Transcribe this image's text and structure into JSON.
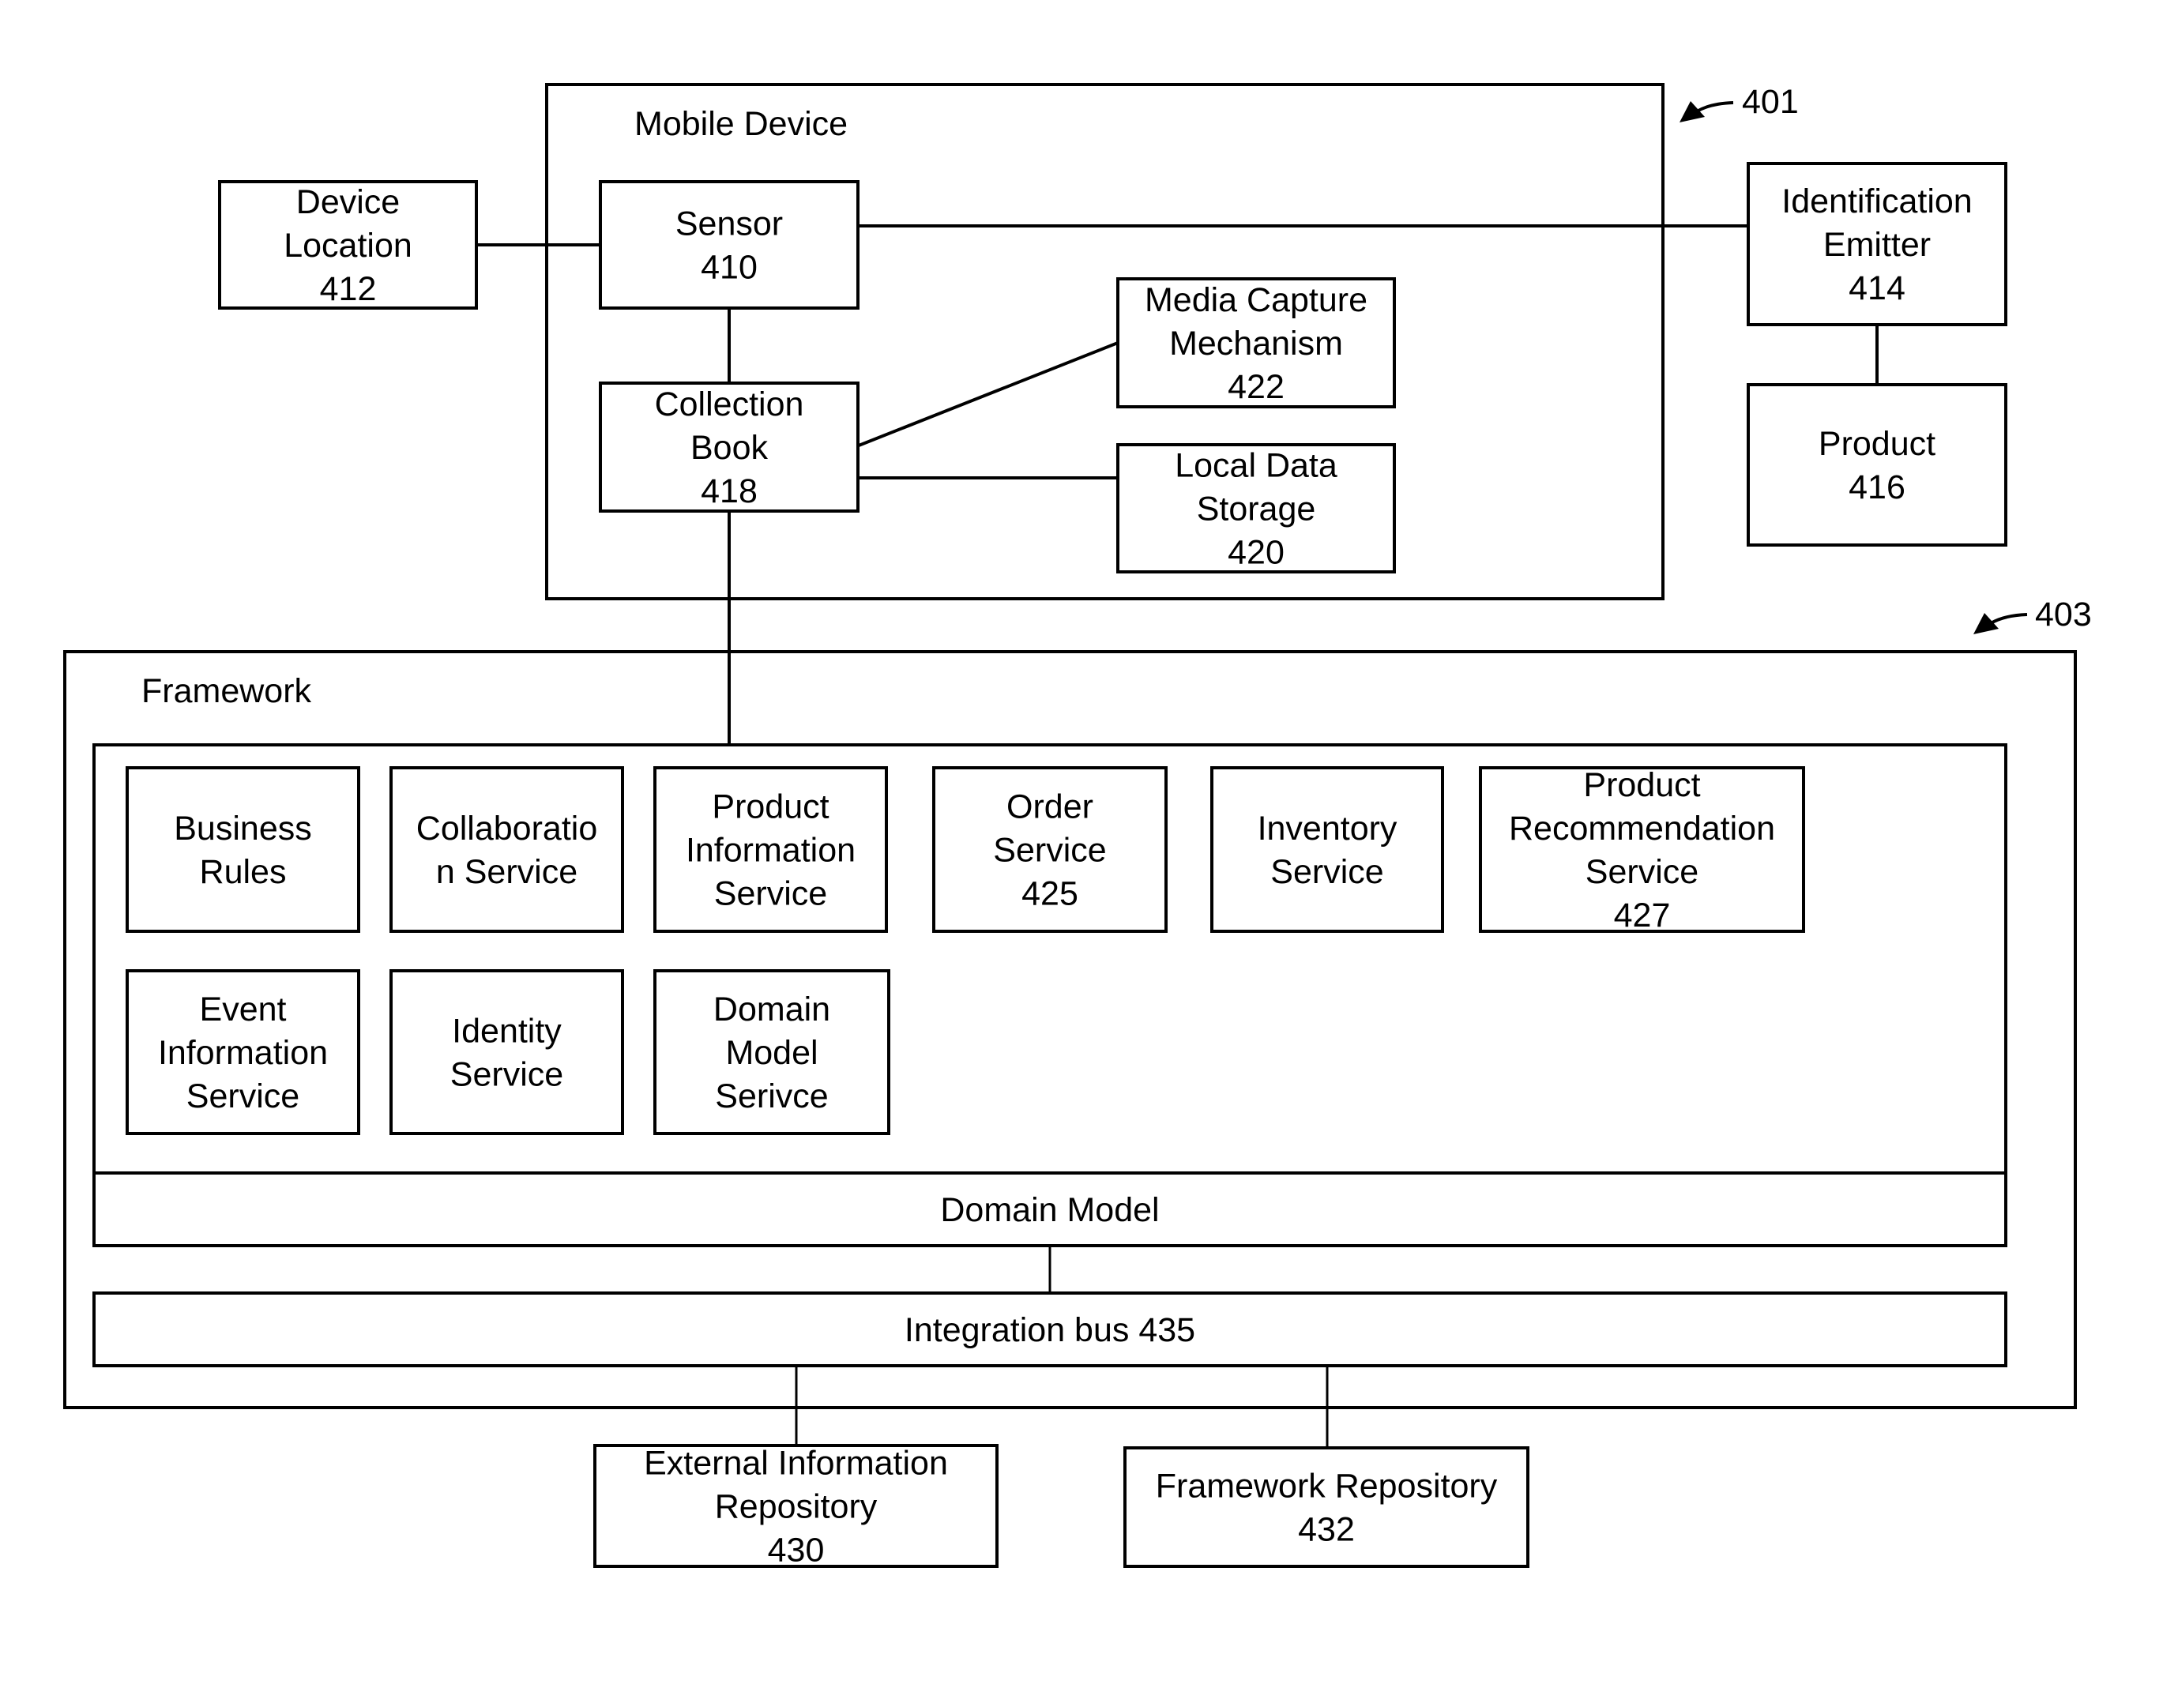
{
  "diagram": {
    "callouts": [
      {
        "id": "mobile-device-ref",
        "label": "401"
      },
      {
        "id": "framework-ref",
        "label": "403"
      }
    ],
    "mobile_device": {
      "title": "Mobile Device"
    },
    "framework": {
      "title": "Framework"
    },
    "nodes": {
      "device_location": {
        "lines": [
          "Device",
          "Location",
          "412"
        ]
      },
      "sensor": {
        "lines": [
          "Sensor",
          "410"
        ]
      },
      "collection_book": {
        "lines": [
          "Collection",
          "Book",
          "418"
        ]
      },
      "media_capture": {
        "lines": [
          "Media Capture",
          "Mechanism",
          "422"
        ]
      },
      "local_data_storage": {
        "lines": [
          "Local Data",
          "Storage",
          "420"
        ]
      },
      "identification_emitter": {
        "lines": [
          "Identification",
          "Emitter",
          "414"
        ]
      },
      "product": {
        "lines": [
          "Product",
          "416"
        ]
      },
      "business_rules": {
        "lines": [
          "Business",
          "Rules"
        ]
      },
      "collaboration_service": {
        "lines": [
          "Collaboratio",
          "n Service"
        ]
      },
      "product_information_service": {
        "lines": [
          "Product",
          "Information",
          "Service"
        ]
      },
      "order_service": {
        "lines": [
          "Order",
          "Service",
          "425"
        ]
      },
      "inventory_service": {
        "lines": [
          "Inventory",
          "Service"
        ]
      },
      "product_recommendation_service": {
        "lines": [
          "Product",
          "Recommendation",
          "Service",
          "427"
        ]
      },
      "event_information_service": {
        "lines": [
          "Event",
          "Information",
          "Service"
        ]
      },
      "identity_service": {
        "lines": [
          "Identity",
          "Service"
        ]
      },
      "domain_model_service": {
        "lines": [
          "Domain",
          "Model",
          "Serivce"
        ]
      },
      "domain_model": {
        "lines": [
          "Domain Model"
        ]
      },
      "integration_bus": {
        "lines": [
          "Integration bus 435"
        ]
      },
      "external_information_repository": {
        "lines": [
          "External Information",
          "Repository",
          "430"
        ]
      },
      "framework_repository": {
        "lines": [
          "Framework Repository",
          "432"
        ]
      }
    },
    "connections": [
      {
        "from": "device_location",
        "to": "sensor"
      },
      {
        "from": "sensor",
        "to": "identification_emitter"
      },
      {
        "from": "sensor",
        "to": "collection_book"
      },
      {
        "from": "collection_book",
        "to": "media_capture"
      },
      {
        "from": "collection_book",
        "to": "local_data_storage"
      },
      {
        "from": "collection_book",
        "to": "framework"
      },
      {
        "from": "identification_emitter",
        "to": "product"
      },
      {
        "from": "domain_model",
        "to": "integration_bus"
      },
      {
        "from": "integration_bus",
        "to": "external_information_repository"
      },
      {
        "from": "integration_bus",
        "to": "framework_repository"
      }
    ]
  }
}
